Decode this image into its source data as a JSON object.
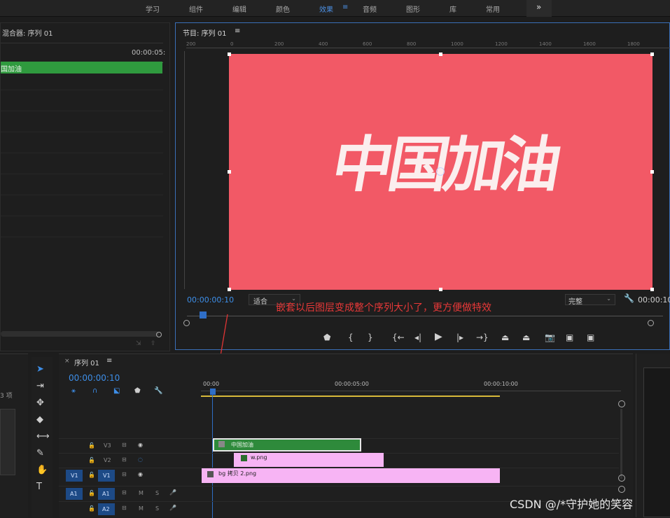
{
  "workspaces": [
    "学习",
    "组件",
    "编辑",
    "颜色",
    "效果",
    "音频",
    "图形",
    "库",
    "常用"
  ],
  "workspace_active_index": 4,
  "workspace_overflow": "»",
  "left_panel": {
    "title": "混合器: 序列 01",
    "timecode": "00:00:05:",
    "clip_label": "国加油",
    "items_count": "3 项"
  },
  "program": {
    "title": "节目: 序列 01",
    "menu_icon": "≡",
    "ruler_ticks": [
      "200",
      "0",
      "200",
      "400",
      "600",
      "800",
      "1000",
      "1200",
      "1400",
      "1600",
      "1800"
    ],
    "canvas_text": "中国加油",
    "canvas_color": "#f25966",
    "current_time": "00:00:00:10",
    "fit_label": "适合",
    "quality_label": "完整",
    "end_time": "00:00:10"
  },
  "annotation": "嵌套以后图层变成整个序列大小了，更方便做特效",
  "timeline": {
    "tab_title": "序列 01",
    "timecode": "00:00:00:10",
    "ruler_labels": [
      "00:00",
      "00:00:05:00",
      "00:00:10:00"
    ],
    "tracks": [
      {
        "name": "V3",
        "source": ""
      },
      {
        "name": "V2",
        "source": ""
      },
      {
        "name": "V1",
        "source": "V1"
      },
      {
        "name": "A1",
        "source": "A1",
        "mute": "M",
        "solo": "S"
      },
      {
        "name": "A2",
        "source": "",
        "mute": "M",
        "solo": "S"
      }
    ],
    "clips": {
      "nested": "中国加油",
      "v2": "w.png",
      "v1": "bg 拷贝 2.png"
    }
  },
  "watermark": "CSDN @/*守护她的笑容"
}
